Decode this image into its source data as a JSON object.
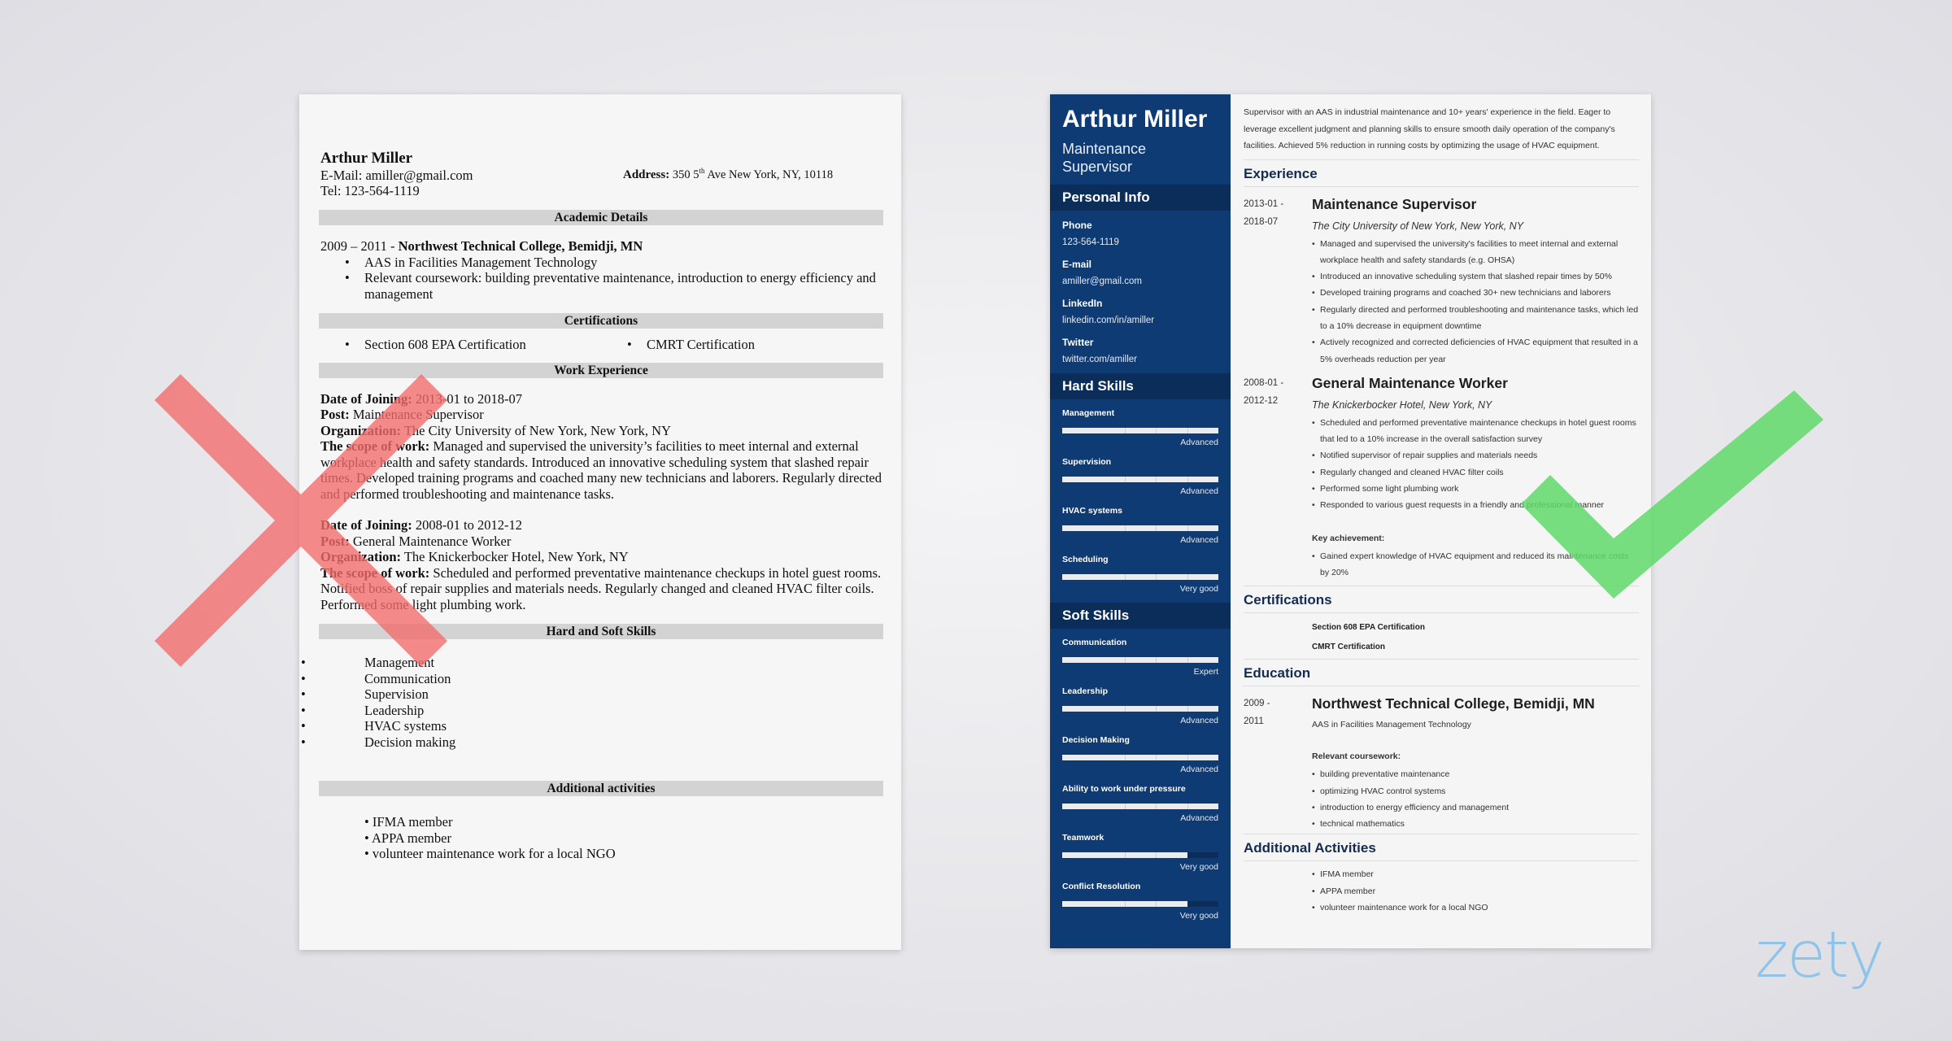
{
  "bad_resume": {
    "name": "Arthur Miller",
    "email_label": "E-Mail:",
    "email": "amiller@gmail.com",
    "tel_label": "Tel:",
    "tel": "123-564-1119",
    "address_label": "Address:",
    "address_pre": "350 5",
    "address_sup": "th",
    "address_post": " Ave New York, NY, 10118",
    "sections": {
      "academic": "Academic Details",
      "certifications": "Certifications",
      "work": "Work Experience",
      "skills": "Hard and Soft Skills",
      "activities": "Additional activities"
    },
    "education": {
      "years": "2009 – 2011 - ",
      "school": "Northwest Technical College, Bemidji, MN",
      "bullets": [
        "AAS in Facilities Management Technology",
        "Relevant coursework: building preventative maintenance, introduction to energy efficiency and management"
      ]
    },
    "certifications": [
      "Section 608 EPA Certification",
      "CMRT Certification"
    ],
    "jobs": [
      {
        "date_label": "Date of Joining:",
        "date": " 2013-01 to 2018-07",
        "post_label": "Post:",
        "post": " Maintenance Supervisor",
        "org_label": "Organization:",
        "org": " The City University of New York, New York, NY",
        "scope_label": "The scope of work:",
        "scope": " Managed and supervised the university’s facilities to meet internal and external workplace health and safety standards. Introduced an innovative scheduling system that slashed repair times. Developed training programs and coached many new technicians and laborers. Regularly directed and performed troubleshooting and maintenance tasks."
      },
      {
        "date_label": "Date of Joining:",
        "date": " 2008-01 to 2012-12",
        "post_label": "Post:",
        "post": " General Maintenance Worker",
        "org_label": "Organization:",
        "org": " The Knickerbocker Hotel, New York, NY",
        "scope_label": "The scope of work:",
        "scope": " Scheduled and performed preventative maintenance checkups in hotel guest rooms. Notified boss of repair supplies and materials needs. Regularly changed and cleaned HVAC filter coils. Performed some light plumbing work."
      }
    ],
    "skills": [
      "Management",
      "Communication",
      "Supervision",
      "Leadership",
      "HVAC systems",
      "Decision making"
    ],
    "activities": [
      "• IFMA member",
      "• APPA member",
      "• volunteer maintenance work for a local NGO"
    ]
  },
  "good_resume": {
    "name": "Arthur Miller",
    "title": "Maintenance Supervisor",
    "sidebar": {
      "personal_heading": "Personal Info",
      "personal": [
        {
          "label": "Phone",
          "value": "123-564-1119"
        },
        {
          "label": "E-mail",
          "value": "amiller@gmail.com"
        },
        {
          "label": "LinkedIn",
          "value": "linkedin.com/in/amiller"
        },
        {
          "label": "Twitter",
          "value": "twitter.com/amiller"
        }
      ],
      "hard_heading": "Hard Skills",
      "hard_skills": [
        {
          "name": "Management",
          "level": "Advanced",
          "fill": 1.0
        },
        {
          "name": "Supervision",
          "level": "Advanced",
          "fill": 1.0
        },
        {
          "name": "HVAC systems",
          "level": "Advanced",
          "fill": 1.0
        },
        {
          "name": "Scheduling",
          "level": "Very good",
          "fill": 1.0
        }
      ],
      "soft_heading": "Soft Skills",
      "soft_skills": [
        {
          "name": "Communication",
          "level": "Expert",
          "fill": 1.0
        },
        {
          "name": "Leadership",
          "level": "Advanced",
          "fill": 1.0
        },
        {
          "name": "Decision Making",
          "level": "Advanced",
          "fill": 1.0
        },
        {
          "name": "Ability to work under pressure",
          "level": "Advanced",
          "fill": 1.0
        },
        {
          "name": "Teamwork",
          "level": "Very good",
          "fill": 0.8
        },
        {
          "name": "Conflict Resolution",
          "level": "Very good",
          "fill": 0.8
        }
      ]
    },
    "summary": "Supervisor with an AAS in industrial maintenance and 10+ years' experience in the field. Eager to leverage excellent judgment and planning skills to ensure smooth daily operation of the company's facilities. Achieved 5% reduction in running costs by optimizing the usage of HVAC equipment.",
    "experience_heading": "Experience",
    "jobs": [
      {
        "date_start": "2013-01 -",
        "date_end": "2018-07",
        "role": "Maintenance Supervisor",
        "org": "The City University of New York, New York, NY",
        "bullets": [
          "Managed and supervised the university's facilities to meet internal and external workplace health and safety standards (e.g. OHSA)",
          "Introduced an innovative scheduling system that slashed repair times by 50%",
          "Developed training programs and coached 30+ new technicians and laborers",
          "Regularly directed and performed troubleshooting and maintenance tasks, which led to a 10% decrease in equipment downtime",
          "Actively recognized and corrected deficiencies of HVAC equipment that resulted in a 5% overheads reduction per year"
        ]
      },
      {
        "date_start": "2008-01 -",
        "date_end": "2012-12",
        "role": "General Maintenance Worker",
        "org": "The Knickerbocker Hotel, New York, NY",
        "bullets": [
          "Scheduled and performed preventative maintenance checkups in hotel guest rooms that led to a 10% increase in the overall satisfaction survey",
          "Notified supervisor of repair supplies and materials needs",
          "Regularly changed and cleaned HVAC filter coils",
          "Performed some light plumbing work",
          "Responded to various guest requests in a friendly and professional manner"
        ],
        "key_label": "Key achievement:",
        "key_bullets": [
          "Gained expert knowledge of HVAC equipment and reduced its maintenance costs by 20%"
        ]
      }
    ],
    "certifications_heading": "Certifications",
    "certifications": [
      "Section 608 EPA Certification",
      "CMRT Certification"
    ],
    "education_heading": "Education",
    "education": {
      "date_start": "2009 -",
      "date_end": "2011",
      "school": "Northwest Technical College, Bemidji, MN",
      "degree": "AAS in Facilities Management Technology",
      "coursework_label": "Relevant coursework:",
      "coursework": [
        "building preventative maintenance",
        "optimizing HVAC control systems",
        "introduction to energy efficiency and management",
        "technical mathematics"
      ]
    },
    "activities_heading": "Additional Activities",
    "activities": [
      "IFMA member",
      "APPA member",
      "volunteer maintenance work for a local NGO"
    ]
  },
  "marks": {
    "bad": "x-icon",
    "good": "checkmark-icon",
    "bad_color": "#f36b6b",
    "good_color": "#5fd968"
  },
  "brand": {
    "logo": "zety",
    "color": "#8ec3ea",
    "sidebar_color": "#0e3b74"
  }
}
